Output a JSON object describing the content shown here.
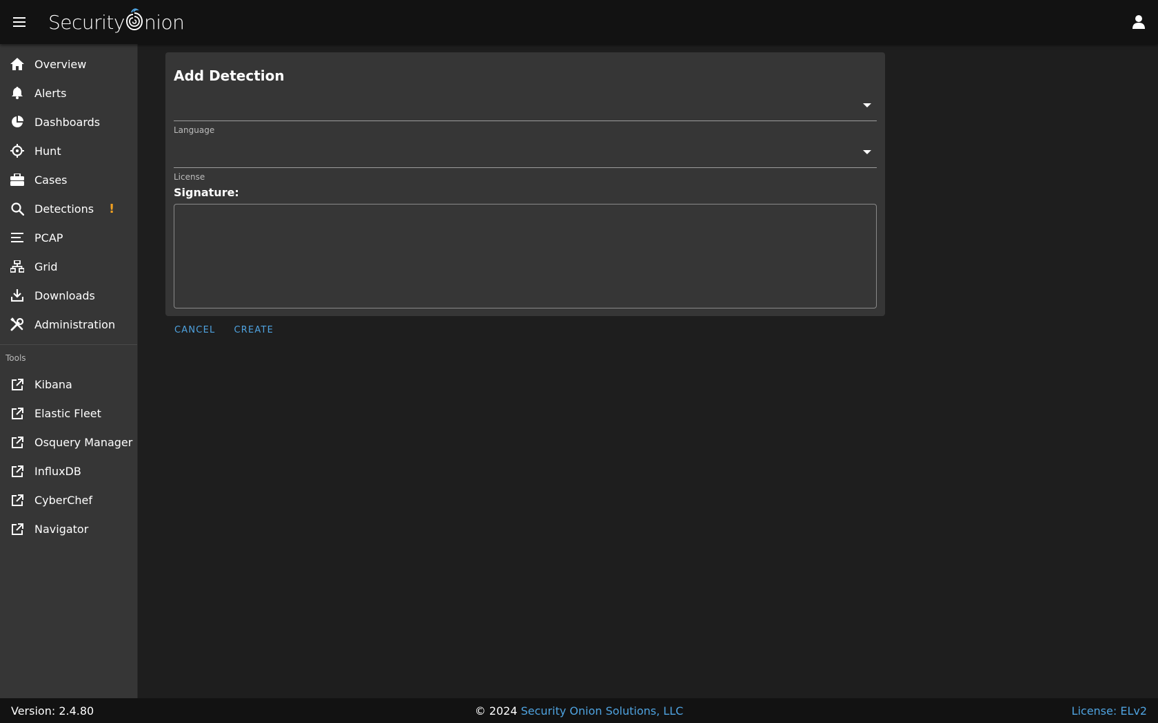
{
  "header": {
    "logo_text_before": "Security",
    "logo_text_after": "nion"
  },
  "sidebar": {
    "items": [
      {
        "label": "Overview",
        "icon": "home-icon"
      },
      {
        "label": "Alerts",
        "icon": "bell-icon"
      },
      {
        "label": "Dashboards",
        "icon": "pie-chart-icon"
      },
      {
        "label": "Hunt",
        "icon": "crosshairs-icon"
      },
      {
        "label": "Cases",
        "icon": "briefcase-icon"
      },
      {
        "label": "Detections",
        "icon": "search-icon",
        "badge": "!"
      },
      {
        "label": "PCAP",
        "icon": "lines-icon"
      },
      {
        "label": "Grid",
        "icon": "network-icon"
      },
      {
        "label": "Downloads",
        "icon": "download-icon"
      },
      {
        "label": "Administration",
        "icon": "tools-icon"
      }
    ],
    "tools_label": "Tools",
    "tools": [
      {
        "label": "Kibana"
      },
      {
        "label": "Elastic Fleet"
      },
      {
        "label": "Osquery Manager"
      },
      {
        "label": "InfluxDB"
      },
      {
        "label": "CyberChef"
      },
      {
        "label": "Navigator"
      }
    ]
  },
  "form": {
    "title": "Add Detection",
    "language_label": "Language",
    "language_value": "",
    "license_label": "License",
    "license_value": "",
    "signature_label": "Signature:",
    "signature_value": "",
    "cancel_label": "CANCEL",
    "create_label": "CREATE"
  },
  "footer": {
    "version": "Version: 2.4.80",
    "copyright_prefix": "© 2024",
    "company": "Security Onion Solutions, LLC",
    "license": "License: ELv2"
  },
  "colors": {
    "accent": "#4fa3e0",
    "warning": "#f0a020",
    "topbar": "#121212",
    "sidebar": "#363636",
    "background": "#1e1e1e"
  }
}
